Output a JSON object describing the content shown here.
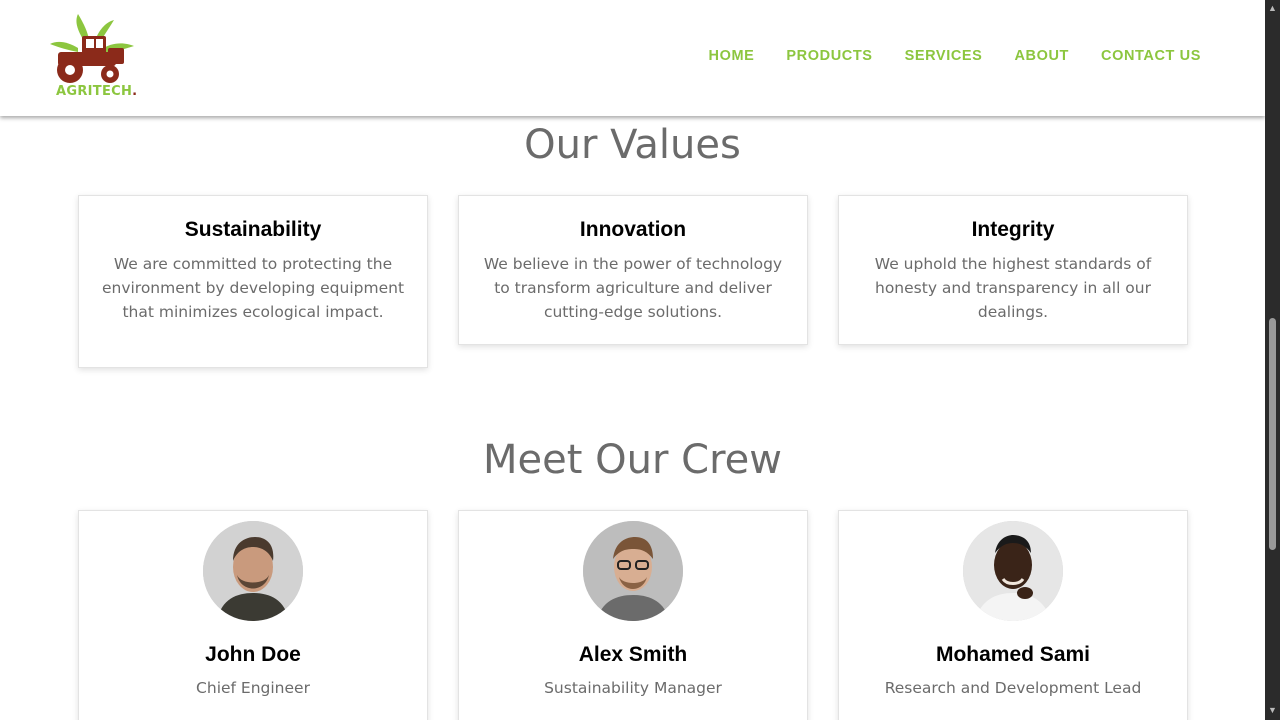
{
  "brand": {
    "logo_text": "AGRITECH",
    "logo_dot": ".",
    "accent_color": "#8cc63f",
    "logo_icon": "tractor-leaf-logo-icon"
  },
  "nav": {
    "items": [
      "HOME",
      "PRODUCTS",
      "SERVICES",
      "ABOUT",
      "CONTACT US"
    ]
  },
  "values": {
    "title": "Our Values",
    "cards": [
      {
        "title": "Sustainability",
        "text": "We are committed to protecting the environment by developing equipment that minimizes ecological impact."
      },
      {
        "title": "Innovation",
        "text": "We believe in the power of technology to transform agriculture and deliver cutting-edge solutions."
      },
      {
        "title": "Integrity",
        "text": "We uphold the highest standards of honesty and transparency in all our dealings."
      }
    ]
  },
  "crew": {
    "title": "Meet Our Crew",
    "members": [
      {
        "name": "John Doe",
        "role": "Chief Engineer"
      },
      {
        "name": "Alex Smith",
        "role": "Sustainability Manager"
      },
      {
        "name": "Mohamed Sami",
        "role": "Research and Development Lead"
      }
    ]
  }
}
